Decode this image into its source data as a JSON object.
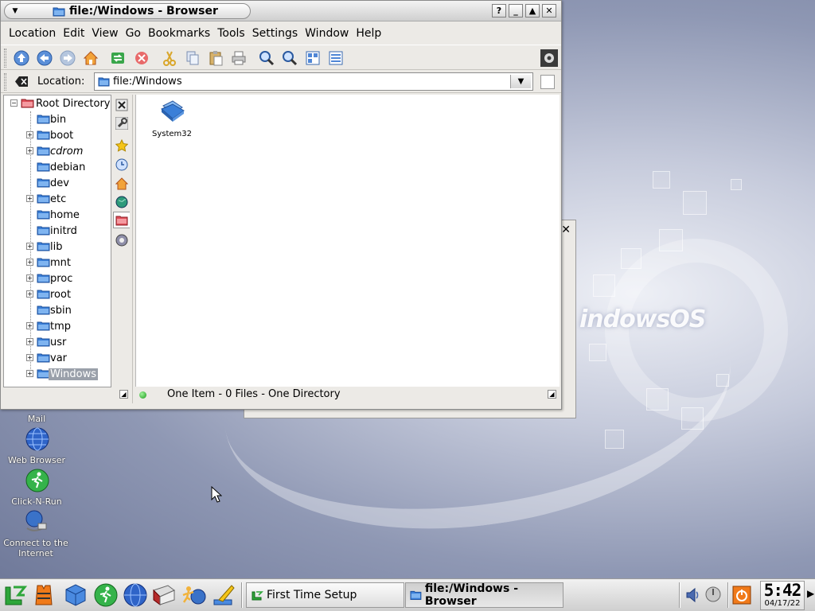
{
  "window": {
    "title": "file:/Windows - Browser",
    "title_buttons": [
      "?",
      "_",
      "▲",
      "✕"
    ]
  },
  "menubar": {
    "items": [
      "Location",
      "Edit",
      "View",
      "Go",
      "Bookmarks",
      "Tools",
      "Settings",
      "Window",
      "Help"
    ]
  },
  "toolbar": {
    "icons": [
      "up-arrow-icon",
      "back-arrow-icon",
      "forward-arrow-icon",
      "home-icon",
      "reload-icon",
      "stop-icon",
      "cut-icon",
      "copy-icon",
      "paste-icon",
      "print-icon",
      "zoom-in-icon",
      "zoom-out-icon",
      "icon-view-icon",
      "detail-view-icon",
      "activity-gear-icon"
    ]
  },
  "location": {
    "label": "Location:",
    "value": "file:/Windows"
  },
  "tree": {
    "root": "Root Directory",
    "items": [
      {
        "label": "bin",
        "expandable": false
      },
      {
        "label": "boot",
        "expandable": true
      },
      {
        "label": "cdrom",
        "expandable": true,
        "italic": true
      },
      {
        "label": "debian",
        "expandable": false
      },
      {
        "label": "dev",
        "expandable": false
      },
      {
        "label": "etc",
        "expandable": true
      },
      {
        "label": "home",
        "expandable": false
      },
      {
        "label": "initrd",
        "expandable": false
      },
      {
        "label": "lib",
        "expandable": true
      },
      {
        "label": "mnt",
        "expandable": true
      },
      {
        "label": "proc",
        "expandable": true
      },
      {
        "label": "root",
        "expandable": true
      },
      {
        "label": "sbin",
        "expandable": false
      },
      {
        "label": "tmp",
        "expandable": true
      },
      {
        "label": "usr",
        "expandable": true
      },
      {
        "label": "var",
        "expandable": true
      },
      {
        "label": "Windows",
        "expandable": true,
        "selected": true
      }
    ]
  },
  "sidebar_tabs": [
    "close-icon",
    "wrench-icon",
    "star-icon",
    "clock-icon",
    "home-icon",
    "globe-icon",
    "folder-icon",
    "services-icon"
  ],
  "files": [
    {
      "name": "System32",
      "icon": "folder-icon"
    }
  ],
  "status": {
    "text": "One Item - 0 Files - One Directory"
  },
  "desktop": {
    "icons": [
      {
        "label": "Mail",
        "icon": "mail-icon"
      },
      {
        "label": "Web Browser",
        "icon": "globe-icon"
      },
      {
        "label": "Click-N-Run",
        "icon": "run-icon"
      },
      {
        "label": "Connect to the Internet",
        "icon": "connect-icon"
      }
    ],
    "wallpaper_logo": "indowsOS"
  },
  "taskbar": {
    "tasks": [
      {
        "label": "First Time Setup",
        "active": false
      },
      {
        "label": "file:/Windows - Browser",
        "active": true
      }
    ],
    "clock": {
      "time": "5:42",
      "date": "04/17/22"
    }
  },
  "colors": {
    "folder_blue": "#3a7fd8",
    "selection": "#9aa0aa",
    "window_bg": "#eceae6"
  }
}
